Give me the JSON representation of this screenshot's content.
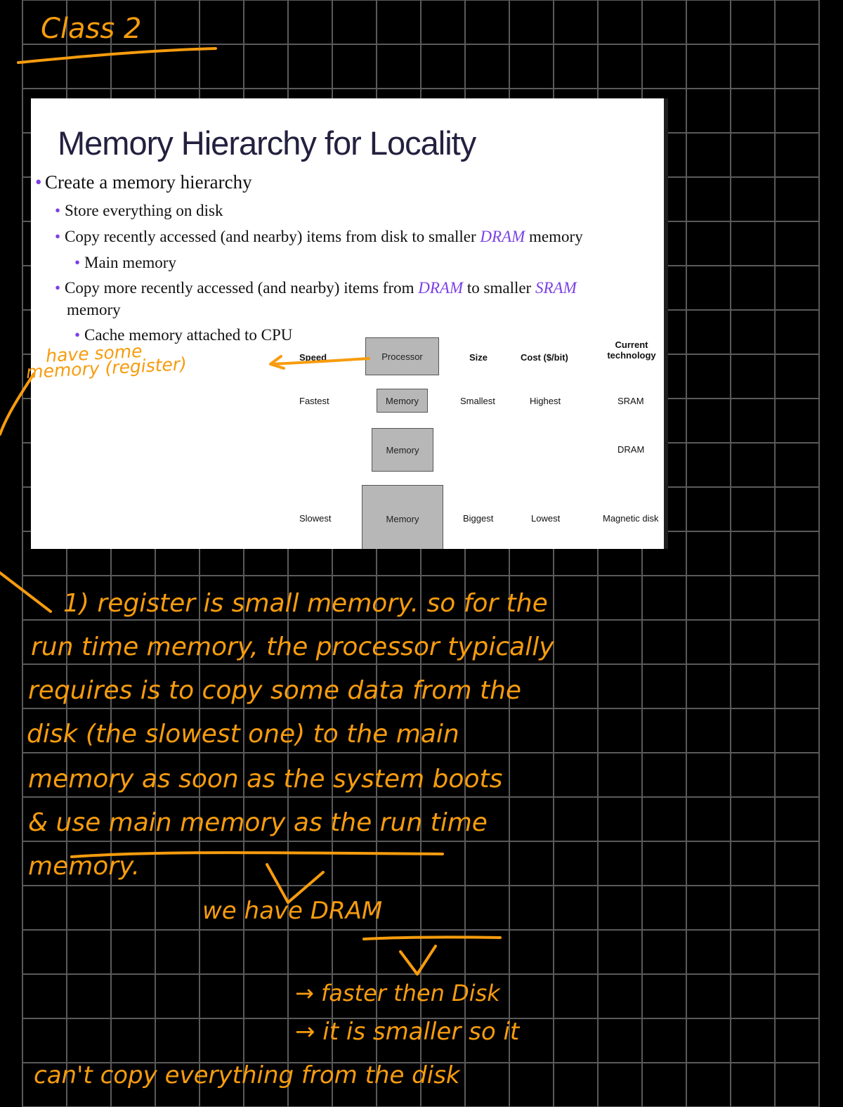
{
  "colors": {
    "background": "#000000",
    "grid": "#5a5a5a",
    "ink": "#f79c0e",
    "slide_title": "#23203f",
    "accent": "#7b3fe4",
    "box_fill": "#b7b7b7"
  },
  "notes_header": "Class 2",
  "slide": {
    "title": "Memory Hierarchy for Locality",
    "bullets": [
      {
        "level": 1,
        "text": "Create a memory hierarchy"
      },
      {
        "level": 2,
        "text": "Store everything on disk"
      },
      {
        "level": 2,
        "pre": "Copy recently accessed (and nearby) items from disk to smaller ",
        "hl1": "DRAM",
        "post": " memory"
      },
      {
        "level": 3,
        "text": "Main memory"
      },
      {
        "level": 2,
        "pre": "Copy more recently accessed (and nearby) items from ",
        "hl1": "DRAM",
        "mid": " to smaller ",
        "hl2": "SRAM",
        "line2": "memory"
      },
      {
        "level": 3,
        "text": "Cache memory attached to CPU"
      }
    ],
    "diagram": {
      "headers": {
        "speed": "Speed",
        "size": "Size",
        "cost": "Cost ($/bit)",
        "tech_line1": "Current",
        "tech_line2": "technology"
      },
      "processor_label": "Processor",
      "levels": [
        {
          "label": "Memory",
          "speed": "Fastest",
          "size": "Smallest",
          "cost": "Highest",
          "tech": "SRAM"
        },
        {
          "label": "Memory",
          "speed": "",
          "size": "",
          "cost": "",
          "tech": "DRAM"
        },
        {
          "label": "Memory",
          "speed": "Slowest",
          "size": "Biggest",
          "cost": "Lowest",
          "tech": "Magnetic disk"
        }
      ]
    }
  },
  "annotations": {
    "callout_line1": "have some",
    "callout_line2": "memory (register)",
    "notes_lines": [
      "1) register is small memory. so for the",
      "run time memory, the processor typically",
      "requires is to copy some data from the",
      "disk (the slowest one) to the main",
      "memory as soon as the system boots",
      "& use main memory as the run time",
      "memory."
    ],
    "we_have": "we have DRAM",
    "point1": "→ faster then Disk",
    "point2": "→ it is smaller so it",
    "point3": "can't copy everything from the disk"
  }
}
